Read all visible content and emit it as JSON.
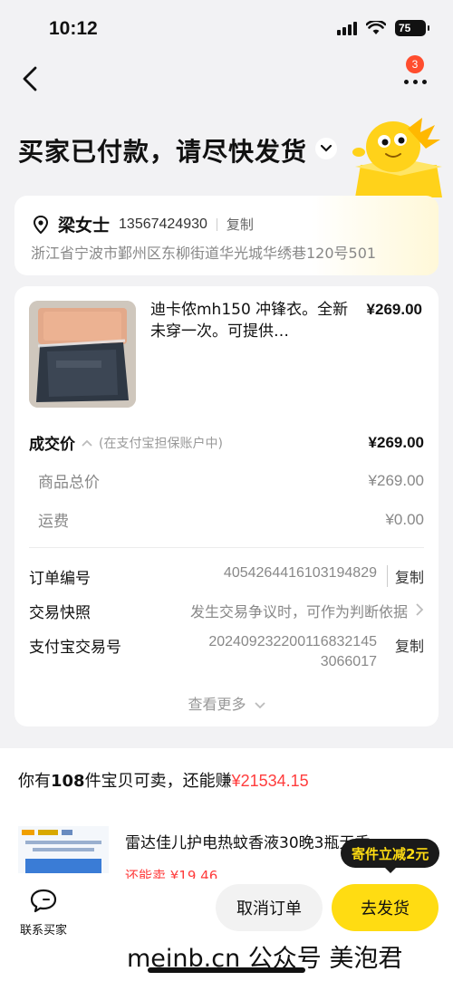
{
  "status_bar": {
    "time": "10:12",
    "battery": "75"
  },
  "header": {
    "notification_count": "3"
  },
  "title": "买家已付款，请尽快发货",
  "address": {
    "name": "梁女士",
    "phone": "13567424930",
    "copy_label": "复制",
    "full": "浙江省宁波市鄞州区东柳街道华光城华绣巷120号501"
  },
  "product": {
    "title": "迪卡侬mh150 冲锋衣。全新未穿一次。可提供…",
    "price": "¥269.00"
  },
  "pricing": {
    "deal_label": "成交价",
    "deal_note": "(在支付宝担保账户中)",
    "deal_value": "¥269.00",
    "goods_label": "商品总价",
    "goods_value": "¥269.00",
    "shipping_label": "运费",
    "shipping_value": "¥0.00"
  },
  "order_info": {
    "order_no_label": "订单编号",
    "order_no": "4054264416103194829",
    "order_no_action": "复制",
    "snapshot_label": "交易快照",
    "snapshot_value": "发生交易争议时，可作为判断依据",
    "alipay_label": "支付宝交易号",
    "alipay_no_line1": "20240923220011683214​5",
    "alipay_no_line2": "3066017",
    "alipay_action": "复制",
    "see_more": "查看更多"
  },
  "promo": {
    "head_prefix": "你有",
    "head_count": "108",
    "head_mid": "件宝贝可卖，还能赚",
    "head_amount": "¥21534.15",
    "item_name": "雷达佳儿护电热蚊香液30晚3瓶无香",
    "item_earn": "还能卖 ¥19.46"
  },
  "bottom": {
    "contact_label": "联系买家",
    "cancel_label": "取消订单",
    "ship_label": "去发货",
    "tip": "寄件立减2元"
  },
  "watermark": "meinb.cn  公众号 美泡君"
}
